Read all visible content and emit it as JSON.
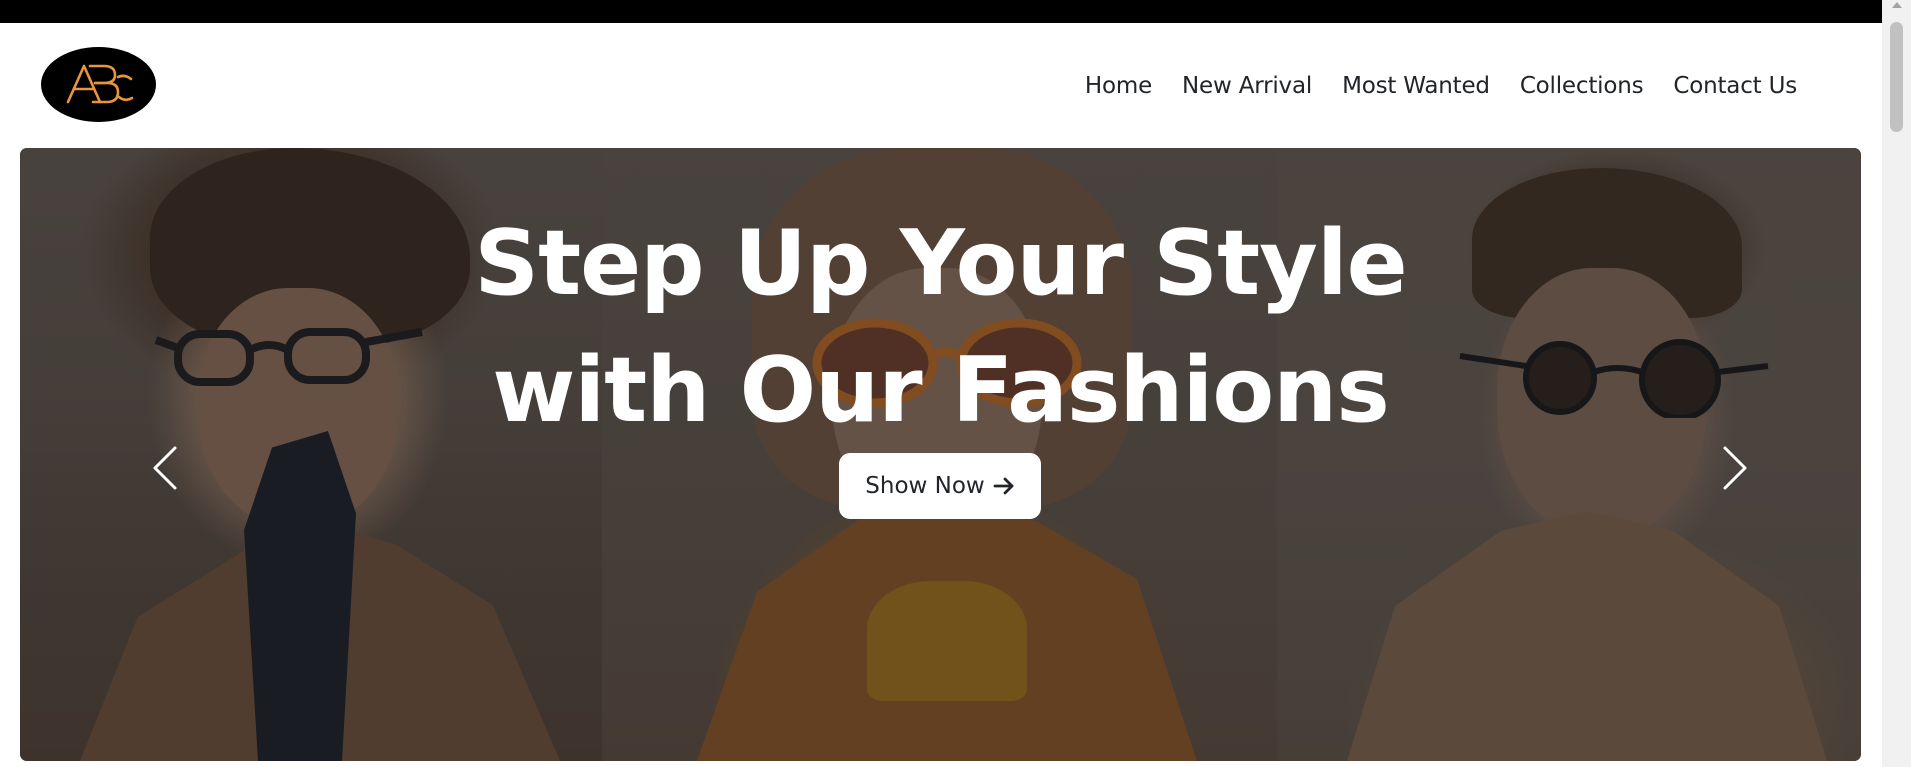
{
  "brand": {
    "logo_text": "ABC",
    "logo_colors": {
      "background": "#000000",
      "letters": "#e8963c"
    }
  },
  "nav": {
    "items": [
      {
        "label": "Home"
      },
      {
        "label": "New Arrival"
      },
      {
        "label": "Most Wanted"
      },
      {
        "label": "Collections"
      },
      {
        "label": "Contact Us"
      }
    ]
  },
  "hero": {
    "title_line1": "Step Up Your Style",
    "title_line2": "with Our Fashions",
    "cta_label": "Show Now",
    "cta_icon": "arrow-right-icon",
    "prev_icon": "chevron-left-icon",
    "next_icon": "chevron-right-icon"
  },
  "colors": {
    "top_bar": "#000000",
    "nav_text": "#212529",
    "hero_text": "#ffffff",
    "button_bg": "#ffffff"
  }
}
